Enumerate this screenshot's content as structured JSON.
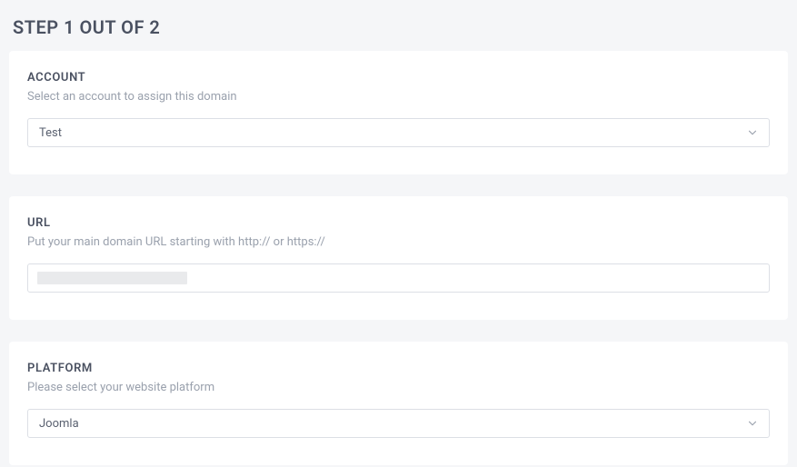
{
  "page": {
    "title": "STEP 1 OUT OF 2"
  },
  "account": {
    "label": "ACCOUNT",
    "description": "Select an account to assign this domain",
    "selected": "Test"
  },
  "url": {
    "label": "URL",
    "description": "Put your main domain URL starting with http:// or https://",
    "value": ""
  },
  "platform": {
    "label": "PLATFORM",
    "description": "Please select your website platform",
    "selected": "Joomla"
  }
}
